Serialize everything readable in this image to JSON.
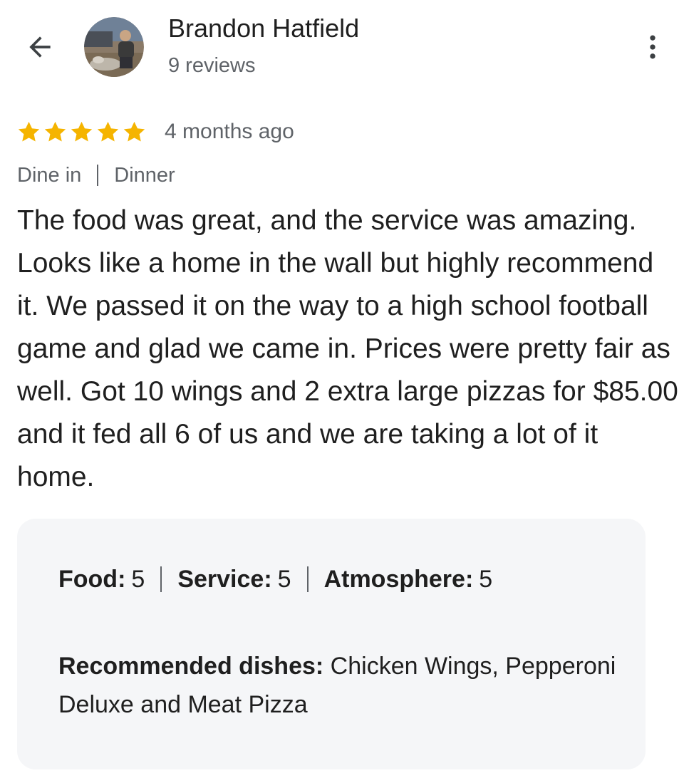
{
  "header": {
    "author_name": "Brandon Hatfield",
    "author_meta": "9 reviews"
  },
  "review": {
    "stars": 5,
    "max_stars": 5,
    "date": "4 months ago",
    "context": [
      "Dine in",
      "Dinner"
    ],
    "text": "The food was great, and the service was amazing. Looks like a home in the wall but highly recommend it. We passed it on the way to a high school football game and glad we came in. Prices were pretty fair as well. Got 10 wings and 2 extra large pizzas for $85.00 and it fed all 6 of us and we are taking a lot of it home."
  },
  "attributes": {
    "ratings": [
      {
        "label": "Food:",
        "value": "5"
      },
      {
        "label": "Service:",
        "value": "5"
      },
      {
        "label": "Atmosphere:",
        "value": "5"
      }
    ],
    "dishes_label": "Recommended dishes:",
    "dishes_value": "Chicken Wings, Pepperoni Deluxe and Meat Pizza"
  },
  "colors": {
    "star": "#f5b400",
    "text_primary": "#1f1f1f",
    "text_secondary": "#5f6368",
    "card_bg": "#f5f6f8"
  },
  "icons": {
    "back": "arrow-back-icon",
    "more": "more-vert-icon",
    "star": "star-icon"
  }
}
